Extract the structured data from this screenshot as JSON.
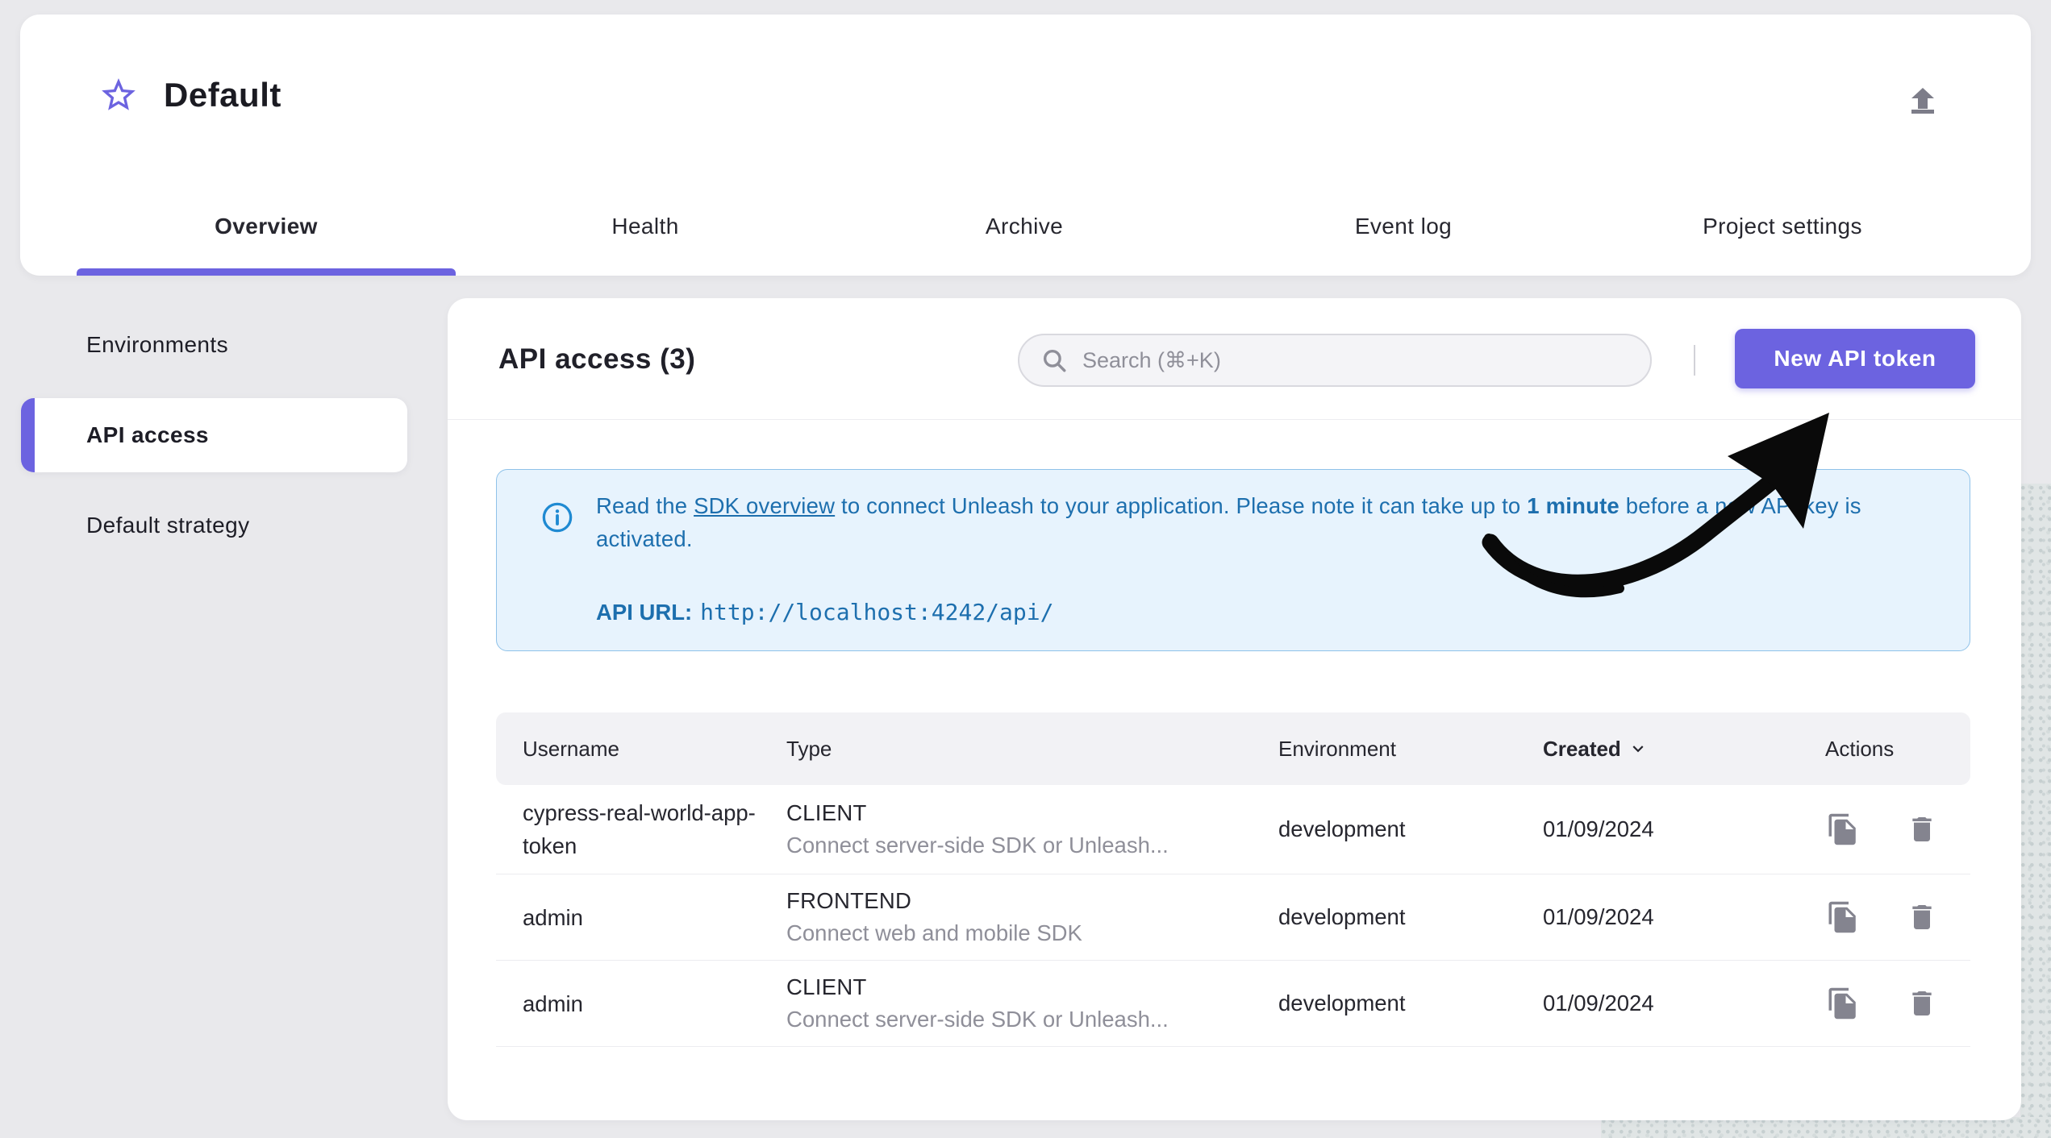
{
  "project": {
    "title": "Default",
    "favorite_icon": "star-outline",
    "export_icon": "upload"
  },
  "tabs": [
    {
      "label": "Overview",
      "active": true
    },
    {
      "label": "Health",
      "active": false
    },
    {
      "label": "Archive",
      "active": false
    },
    {
      "label": "Event log",
      "active": false
    },
    {
      "label": "Project settings",
      "active": false
    }
  ],
  "sidebar": {
    "items": [
      {
        "label": "Environments",
        "active": false
      },
      {
        "label": "API access",
        "active": true
      },
      {
        "label": "Default strategy",
        "active": false
      }
    ]
  },
  "main": {
    "title": "API access (3)",
    "search": {
      "placeholder": "Search (⌘+K)"
    },
    "new_token_button": "New API token",
    "alert": {
      "text_before_link": "Read the ",
      "link": "SDK overview",
      "text_after_link": " to connect Unleash to your application. Please note it can take up to ",
      "bold": "1 minute",
      "text_end": " before a new API key is activated.",
      "api_url_label": "API URL:",
      "api_url": "http://localhost:4242/api/"
    },
    "table": {
      "headers": [
        "Username",
        "Type",
        "Environment",
        "Created",
        "Actions"
      ],
      "sorted_by": "Created",
      "sort_direction": "desc",
      "rows": [
        {
          "username": "cypress-real-world-app-token",
          "type": "CLIENT",
          "type_description": "Connect server-side SDK or Unleash...",
          "environment": "development",
          "created": "01/09/2024"
        },
        {
          "username": "admin",
          "type": "FRONTEND",
          "type_description": "Connect web and mobile SDK",
          "environment": "development",
          "created": "01/09/2024"
        },
        {
          "username": "admin",
          "type": "CLIENT",
          "type_description": "Connect server-side SDK or Unleash...",
          "environment": "development",
          "created": "01/09/2024"
        }
      ]
    }
  },
  "colors": {
    "accent": "#6c63e0",
    "page_bg": "#e9e9ec",
    "alert_bg": "#e7f3fd",
    "alert_text": "#1d6fae",
    "info_icon": "#1f8ad2",
    "icon_gray": "#84848f"
  }
}
